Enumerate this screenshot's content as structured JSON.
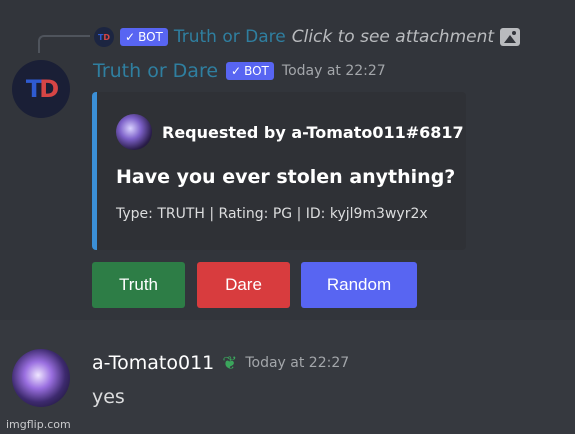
{
  "colors": {
    "accent_blurple": "#5865f2",
    "button_green": "#2d7d46",
    "button_red": "#d83c3e",
    "embed_border": "#3b8fd6",
    "username_teal": "#2f7fa0"
  },
  "reply": {
    "avatar_text": "TD",
    "bot_tag": "BOT",
    "author": "Truth or Dare",
    "preview_text": "Click to see attachment",
    "attachment_icon": "image-icon"
  },
  "message": {
    "avatar_text": "TD",
    "author": "Truth or Dare",
    "bot_tag": "BOT",
    "timestamp": "Today at 22:27",
    "embed": {
      "author_line": "Requested by a-Tomato011#6817",
      "title": "Have you ever stolen anything?",
      "footer": "Type: TRUTH | Rating: PG | ID: kyjl9m3wyr2x"
    },
    "buttons": [
      {
        "label": "Truth"
      },
      {
        "label": "Dare"
      },
      {
        "label": "Random"
      }
    ]
  },
  "reply_message": {
    "author": "a-Tomato011",
    "badge_icon": "sprout-icon",
    "timestamp": "Today at 22:27",
    "text": "yes"
  },
  "watermark": "imgflip.com"
}
